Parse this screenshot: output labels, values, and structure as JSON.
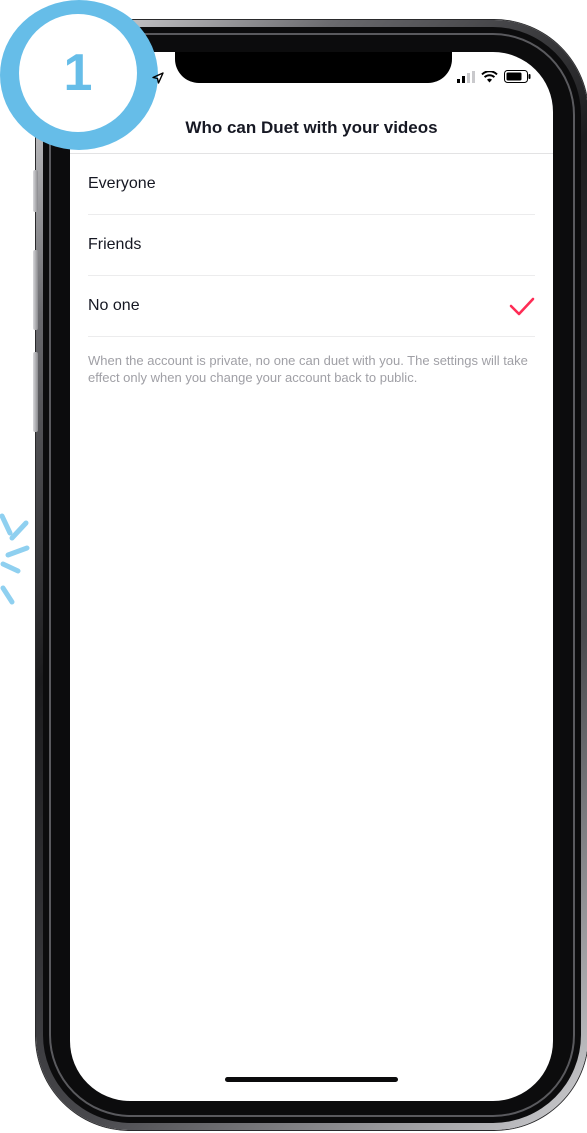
{
  "step_badge": {
    "label": "1"
  },
  "nav": {
    "title": "Who can Duet with your videos"
  },
  "options": [
    {
      "label": "Everyone",
      "selected": false
    },
    {
      "label": "Friends",
      "selected": false
    },
    {
      "label": "No one",
      "selected": true
    }
  ],
  "note": "When the account is private, no one can duet with you. The settings will take effect only when you change your account back to public.",
  "status_icons": [
    "location-arrow-icon",
    "signal-icon",
    "wifi-icon",
    "battery-icon"
  ],
  "colors": {
    "accent_check": "#fe2c55",
    "badge_blue": "#66bde8",
    "text_primary": "#161823",
    "text_secondary": "#a0a0a6"
  }
}
